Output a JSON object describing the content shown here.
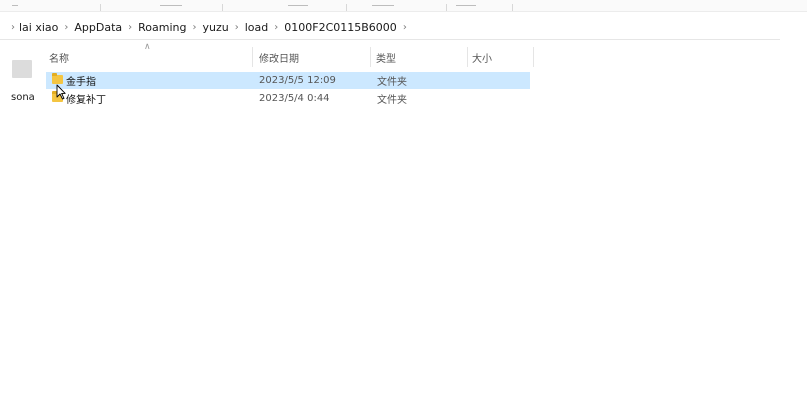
{
  "breadcrumb": {
    "items": [
      "lai xiao",
      "AppData",
      "Roaming",
      "yuzu",
      "load",
      "0100F2C0115B6000"
    ]
  },
  "nav": {
    "partial_label": "sonal"
  },
  "columns": {
    "name": "名称",
    "modified": "修改日期",
    "type": "类型",
    "size": "大小"
  },
  "files": [
    {
      "name": "金手指",
      "modified": "2023/5/5 12:09",
      "type": "文件夹",
      "selected": true
    },
    {
      "name": "修复补丁",
      "modified": "2023/5/4 0:44",
      "type": "文件夹",
      "selected": false
    }
  ],
  "colors": {
    "selection": "#cce8ff",
    "folder": "#f4c542"
  }
}
